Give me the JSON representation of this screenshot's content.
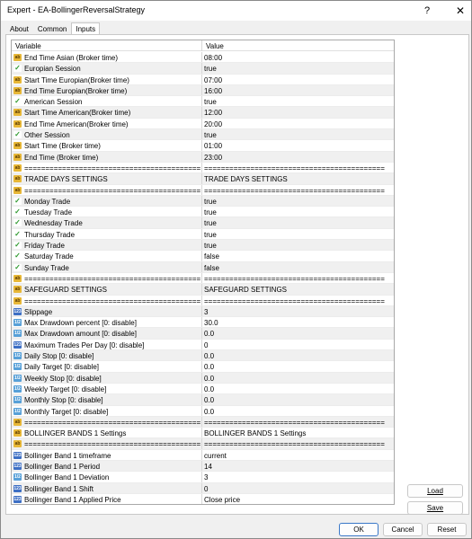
{
  "window": {
    "title": "Expert - EA-BollingerReversalStrategy",
    "help_label": "?",
    "close_label": "✕"
  },
  "tabs": [
    {
      "label": "About"
    },
    {
      "label": "Common"
    },
    {
      "label": "Inputs",
      "active": true
    }
  ],
  "grid": {
    "header_variable": "Variable",
    "header_value": "Value",
    "rows": [
      {
        "icon": "ab",
        "name": "End Time Asian (Broker time)",
        "value": "08:00"
      },
      {
        "icon": "bool",
        "name": "Europian Session",
        "value": "true"
      },
      {
        "icon": "ab",
        "name": "Start Time Europian(Broker time)",
        "value": "07:00"
      },
      {
        "icon": "ab",
        "name": "End Time Europian(Broker time)",
        "value": "16:00"
      },
      {
        "icon": "bool",
        "name": "American Session",
        "value": "true"
      },
      {
        "icon": "ab",
        "name": "Start Time American(Broker time)",
        "value": "12:00"
      },
      {
        "icon": "ab",
        "name": "End Time American(Broker time)",
        "value": "20:00"
      },
      {
        "icon": "bool",
        "name": "Other Session",
        "value": "true"
      },
      {
        "icon": "ab",
        "name": "Start Time (Broker time)",
        "value": "01:00"
      },
      {
        "icon": "ab",
        "name": "End Time (Broker time)",
        "value": "23:00"
      },
      {
        "icon": "ab",
        "name": "==========================================",
        "value": "==========================================="
      },
      {
        "icon": "ab",
        "name": "TRADE DAYS SETTINGS",
        "value": "TRADE DAYS SETTINGS"
      },
      {
        "icon": "ab",
        "name": "==========================================",
        "value": "==========================================="
      },
      {
        "icon": "bool",
        "name": "Monday Trade",
        "value": "true"
      },
      {
        "icon": "bool",
        "name": "Tuesday Trade",
        "value": "true"
      },
      {
        "icon": "bool",
        "name": "Wednesday Trade",
        "value": "true"
      },
      {
        "icon": "bool",
        "name": "Thursday Trade",
        "value": "true"
      },
      {
        "icon": "bool",
        "name": "Friday Trade",
        "value": "true"
      },
      {
        "icon": "bool",
        "name": "Saturday Trade",
        "value": "false"
      },
      {
        "icon": "bool",
        "name": "Sunday Trade",
        "value": "false"
      },
      {
        "icon": "ab",
        "name": "==========================================",
        "value": "==========================================="
      },
      {
        "icon": "ab",
        "name": "SAFEGUARD SETTINGS",
        "value": "SAFEGUARD SETTINGS"
      },
      {
        "icon": "ab",
        "name": "==========================================",
        "value": "==========================================="
      },
      {
        "icon": "num",
        "name": "Slippage",
        "value": "3"
      },
      {
        "icon": "real",
        "name": "Max Drawdown percent [0: disable]",
        "value": "30.0"
      },
      {
        "icon": "real",
        "name": "Max Drawdown amount [0: disable]",
        "value": "0.0"
      },
      {
        "icon": "num",
        "name": "Maximum Trades Per Day [0: disable]",
        "value": "0"
      },
      {
        "icon": "real",
        "name": "Daily Stop [0: disable]",
        "value": "0.0"
      },
      {
        "icon": "real",
        "name": "Daily Target [0: disable]",
        "value": "0.0"
      },
      {
        "icon": "real",
        "name": "Weekly Stop [0: disable]",
        "value": "0.0"
      },
      {
        "icon": "real",
        "name": "Weekly Target [0: disable]",
        "value": "0.0"
      },
      {
        "icon": "real",
        "name": "Monthly Stop [0: disable]",
        "value": "0.0"
      },
      {
        "icon": "real",
        "name": "Monthly Target [0: disable]",
        "value": "0.0"
      },
      {
        "icon": "ab",
        "name": "==========================================",
        "value": "==========================================="
      },
      {
        "icon": "ab",
        "name": "BOLLINGER BANDS 1 Settings",
        "value": "BOLLINGER BANDS 1 Settings"
      },
      {
        "icon": "ab",
        "name": "==========================================",
        "value": "==========================================="
      },
      {
        "icon": "num",
        "name": "Bollinger Band 1 timeframe",
        "value": "current"
      },
      {
        "icon": "num",
        "name": "Bollinger Band 1 Period",
        "value": "14"
      },
      {
        "icon": "real",
        "name": "Bollinger Band 1 Deviation",
        "value": "3"
      },
      {
        "icon": "num",
        "name": "Bollinger Band 1 Shift",
        "value": "0"
      },
      {
        "icon": "num",
        "name": "Bollinger Band 1 Applied Price",
        "value": "Close price"
      }
    ]
  },
  "icons": {
    "ab": "string-param-icon",
    "bool": "bool-param-icon",
    "num": "int-param-icon",
    "real": "double-param-icon"
  },
  "buttons": {
    "load": "Load",
    "save": "Save",
    "ok": "OK",
    "cancel": "Cancel",
    "reset": "Reset"
  }
}
